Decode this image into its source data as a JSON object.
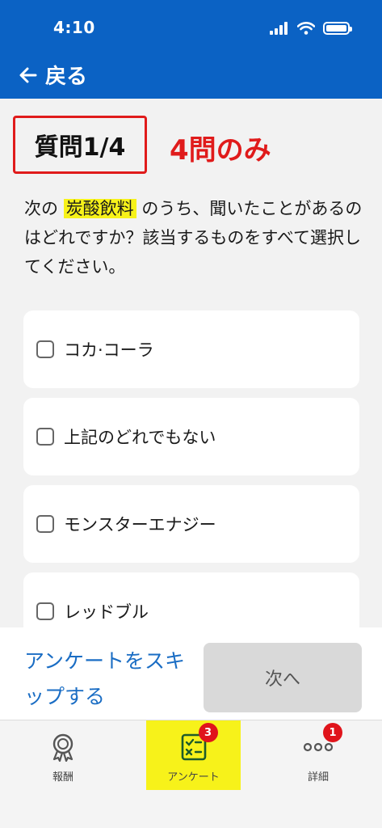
{
  "status_bar": {
    "time": "4:10"
  },
  "header": {
    "back_label": "戻る"
  },
  "question": {
    "number_label": "質問1/4",
    "annotation": "4問のみ",
    "text_before": "次の",
    "highlight": "炭酸飲料",
    "text_after": "のうち、聞いたことがあるのはどれですか？該当するものをすべて選択してください。"
  },
  "options": [
    {
      "label": "コカ·コーラ"
    },
    {
      "label": "上記のどれでもない"
    },
    {
      "label": "モンスターエナジー"
    },
    {
      "label": "レッドブル"
    }
  ],
  "actions": {
    "skip_label": "アンケートをスキップする",
    "next_label": "次へ"
  },
  "tabs": [
    {
      "label": "報酬",
      "icon": "medal-icon"
    },
    {
      "label": "アンケート",
      "icon": "survey-icon",
      "badge": "3"
    },
    {
      "label": "詳細",
      "icon": "more-icon",
      "badge": "1"
    }
  ],
  "colors": {
    "header": "#0b62c4",
    "highlight": "#f7f21a",
    "annotation": "#e01b1b",
    "link": "#1a6dc4",
    "badge": "#e0141b"
  }
}
